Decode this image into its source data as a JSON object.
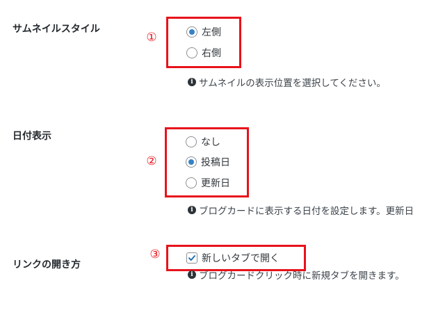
{
  "settings": {
    "thumbnail_style": {
      "label": "サムネイルスタイル",
      "marker": "①",
      "options": [
        {
          "label": "左側",
          "selected": true
        },
        {
          "label": "右側",
          "selected": false
        }
      ],
      "description": "サムネイルの表示位置を選択してください。"
    },
    "date_display": {
      "label": "日付表示",
      "marker": "②",
      "options": [
        {
          "label": "なし",
          "selected": false
        },
        {
          "label": "投稿日",
          "selected": true
        },
        {
          "label": "更新日",
          "selected": false
        }
      ],
      "description": "ブログカードに表示する日付を設定します。更新日"
    },
    "link_open": {
      "label": "リンクの開き方",
      "marker": "③",
      "checkbox_label": "新しいタブで開く",
      "checked": true,
      "description": "ブログカードクリック時に新規タブを開きます。"
    }
  },
  "colors": {
    "highlight_box": "#e8121b",
    "radio_selected": "#3582c4",
    "checkmark": "#2271b1"
  },
  "icons": {
    "info": "info-circle-icon",
    "info_glyph": "i"
  }
}
